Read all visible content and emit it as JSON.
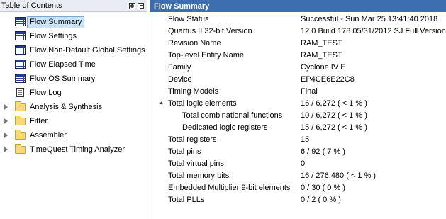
{
  "toc": {
    "title": "Table of Contents",
    "items": [
      {
        "label": "Flow Summary",
        "icon": "table-icon",
        "selected": true
      },
      {
        "label": "Flow Settings",
        "icon": "table-icon"
      },
      {
        "label": "Flow Non-Default Global Settings",
        "icon": "table-icon"
      },
      {
        "label": "Flow Elapsed Time",
        "icon": "table-icon"
      },
      {
        "label": "Flow OS Summary",
        "icon": "table-icon"
      },
      {
        "label": "Flow Log",
        "icon": "document-icon"
      },
      {
        "label": "Analysis & Synthesis",
        "icon": "folder-icon",
        "expandable": true
      },
      {
        "label": "Fitter",
        "icon": "folder-icon",
        "expandable": true
      },
      {
        "label": "Assembler",
        "icon": "folder-icon",
        "expandable": true
      },
      {
        "label": "TimeQuest Timing Analyzer",
        "icon": "folder-icon",
        "expandable": true
      }
    ]
  },
  "summary": {
    "title": "Flow Summary",
    "rows": [
      {
        "key": "Flow Status",
        "value": "Successful - Sun Mar 25 13:41:40 2018"
      },
      {
        "key": "Quartus II 32-bit Version",
        "value": "12.0 Build 178 05/31/2012 SJ Full Version"
      },
      {
        "key": "Revision Name",
        "value": "RAM_TEST"
      },
      {
        "key": "Top-level Entity Name",
        "value": "RAM_TEST"
      },
      {
        "key": "Family",
        "value": "Cyclone IV E"
      },
      {
        "key": "Device",
        "value": "EP4CE6E22C8"
      },
      {
        "key": "Timing Models",
        "value": "Final"
      },
      {
        "key": "Total logic elements",
        "value": "16 / 6,272 ( < 1 % )",
        "expanded": true
      },
      {
        "key": "Total combinational functions",
        "value": "10 / 6,272 ( < 1 % )",
        "child": true
      },
      {
        "key": "Dedicated logic registers",
        "value": "15 / 6,272 ( < 1 % )",
        "child": true
      },
      {
        "key": "Total registers",
        "value": "15"
      },
      {
        "key": "Total pins",
        "value": "6 / 92 ( 7 % )"
      },
      {
        "key": "Total virtual pins",
        "value": "0"
      },
      {
        "key": "Total memory bits",
        "value": "16 / 276,480 ( < 1 % )"
      },
      {
        "key": "Embedded Multiplier 9-bit elements",
        "value": "0 / 30 ( 0 % )"
      },
      {
        "key": "Total PLLs",
        "value": "0 / 2 ( 0 % )"
      }
    ]
  },
  "colors": {
    "header_blue": "#3d6fb0",
    "selection": "#cce4f7",
    "folder": "#f5d97a"
  }
}
